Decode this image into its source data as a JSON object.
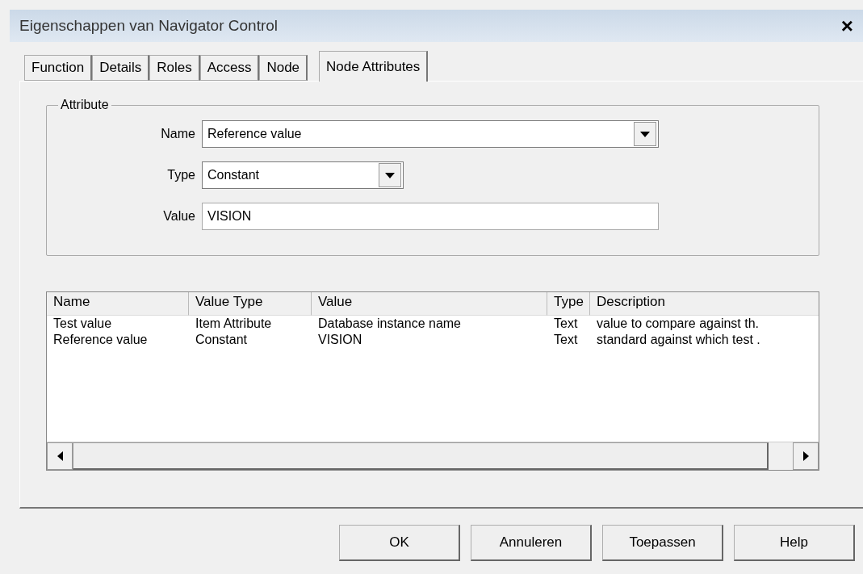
{
  "window": {
    "title": "Eigenschappen van Navigator Control",
    "close": "×"
  },
  "tabs": [
    {
      "label": "Function",
      "selected": false
    },
    {
      "label": "Details",
      "selected": false
    },
    {
      "label": "Roles",
      "selected": false
    },
    {
      "label": "Access",
      "selected": false
    },
    {
      "label": "Node",
      "selected": false
    },
    {
      "label": "Node Attributes",
      "selected": true
    }
  ],
  "attribute": {
    "legend": "Attribute",
    "fields": [
      {
        "kind": "combo",
        "label": "Name",
        "value": "Reference value"
      },
      {
        "kind": "combo",
        "label": "Type",
        "value": "Constant"
      },
      {
        "kind": "text",
        "label": "Value",
        "value": "VISION"
      }
    ]
  },
  "table": {
    "columns": [
      "Name",
      "Value Type",
      "Value",
      "Type",
      "Description"
    ],
    "rows": [
      [
        "Test value",
        "Item Attribute",
        "Database instance name",
        "Text",
        "value to compare against th."
      ],
      [
        "Reference value",
        "Constant",
        "VISION",
        "Text",
        "standard against which test ."
      ]
    ]
  },
  "buttons": [
    "OK",
    "Annuleren",
    "Toepassen",
    "Help"
  ]
}
